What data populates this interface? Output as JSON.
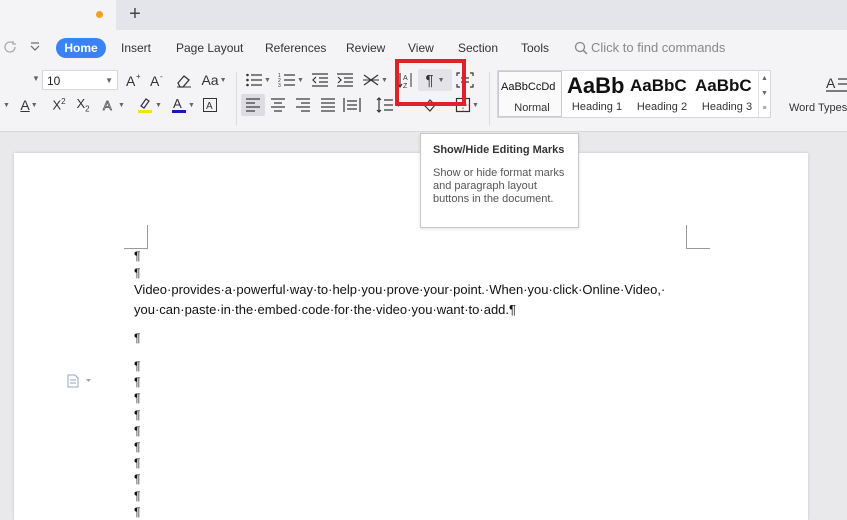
{
  "tabbar": {
    "new_tab_label": "+"
  },
  "menu": {
    "items": [
      "Home",
      "Insert",
      "Page Layout",
      "References",
      "Review",
      "View",
      "Section",
      "Tools"
    ],
    "search_placeholder": "Click to find commands"
  },
  "ribbon": {
    "font_size": "10",
    "styles": [
      {
        "preview": "AaBbCcDd",
        "name": "Normal"
      },
      {
        "preview": "AaBb",
        "name": "Heading 1"
      },
      {
        "preview": "AaBbC",
        "name": "Heading 2"
      },
      {
        "preview": "AaBbC",
        "name": "Heading 3"
      }
    ],
    "word_types_label": "Word Types",
    "show_hide_symbol": "¶"
  },
  "tooltip": {
    "title": "Show/Hide Editing Marks",
    "body": "Show or hide format marks and paragraph layout buttons in the document."
  },
  "document": {
    "pilcrow": "¶",
    "line1": "Video·provides·a·powerful·way·to·help·you·prove·your·point.·When·you·click·Online·Video,·",
    "line2": "you·can·paste·in·the·embed·code·for·the·video·you·want·to·add.¶"
  },
  "colors": {
    "accent": "#3b82f6",
    "highlight": "#e0202a",
    "tab_dot": "#f0a020"
  }
}
